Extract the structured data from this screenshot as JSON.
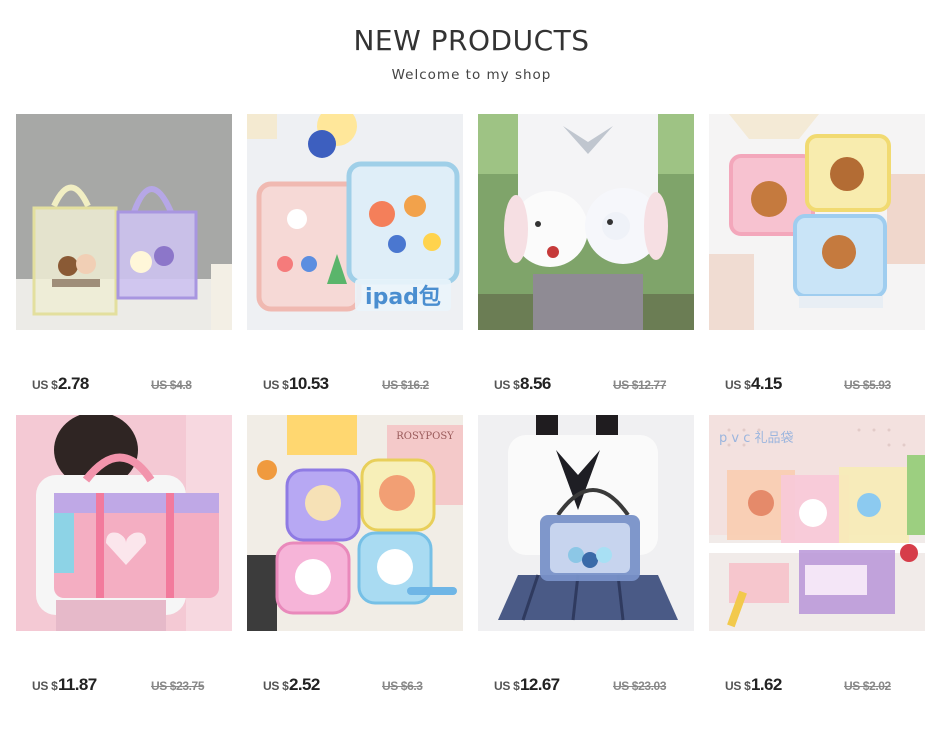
{
  "header": {
    "title": "NEW PRODUCTS",
    "subtitle": "Welcome to my shop"
  },
  "products": [
    {
      "currency": "US $",
      "price": "2.78",
      "old_price": "US $4.8",
      "image": "clear-mesh-tote-bags-photo"
    },
    {
      "currency": "US $",
      "price": "10.53",
      "old_price": "US $16.2",
      "image": "kawaii-ipad-sleeves-photo",
      "image_text": "ipad包"
    },
    {
      "currency": "US $",
      "price": "8.56",
      "old_price": "US $12.77",
      "image": "plush-bunny-backpack-photo"
    },
    {
      "currency": "US $",
      "price": "4.15",
      "old_price": "US $5.93",
      "image": "bear-zipper-pouches-photo"
    },
    {
      "currency": "US $",
      "price": "11.87",
      "old_price": "US $23.75",
      "image": "pink-heart-school-bag-photo"
    },
    {
      "currency": "US $",
      "price": "2.52",
      "old_price": "US $6.3",
      "image": "cartoon-coin-purses-photo",
      "image_text": "ROSYPOSY"
    },
    {
      "currency": "US $",
      "price": "12.67",
      "old_price": "US $23.03",
      "image": "clear-ita-shoulder-bag-photo"
    },
    {
      "currency": "US $",
      "price": "1.62",
      "old_price": "US $2.02",
      "image": "pvc-gift-bags-photo",
      "image_text": "p v c 礼品袋"
    }
  ],
  "colors": {
    "title": "#333333",
    "price": "#222222",
    "old_price": "#888888"
  }
}
